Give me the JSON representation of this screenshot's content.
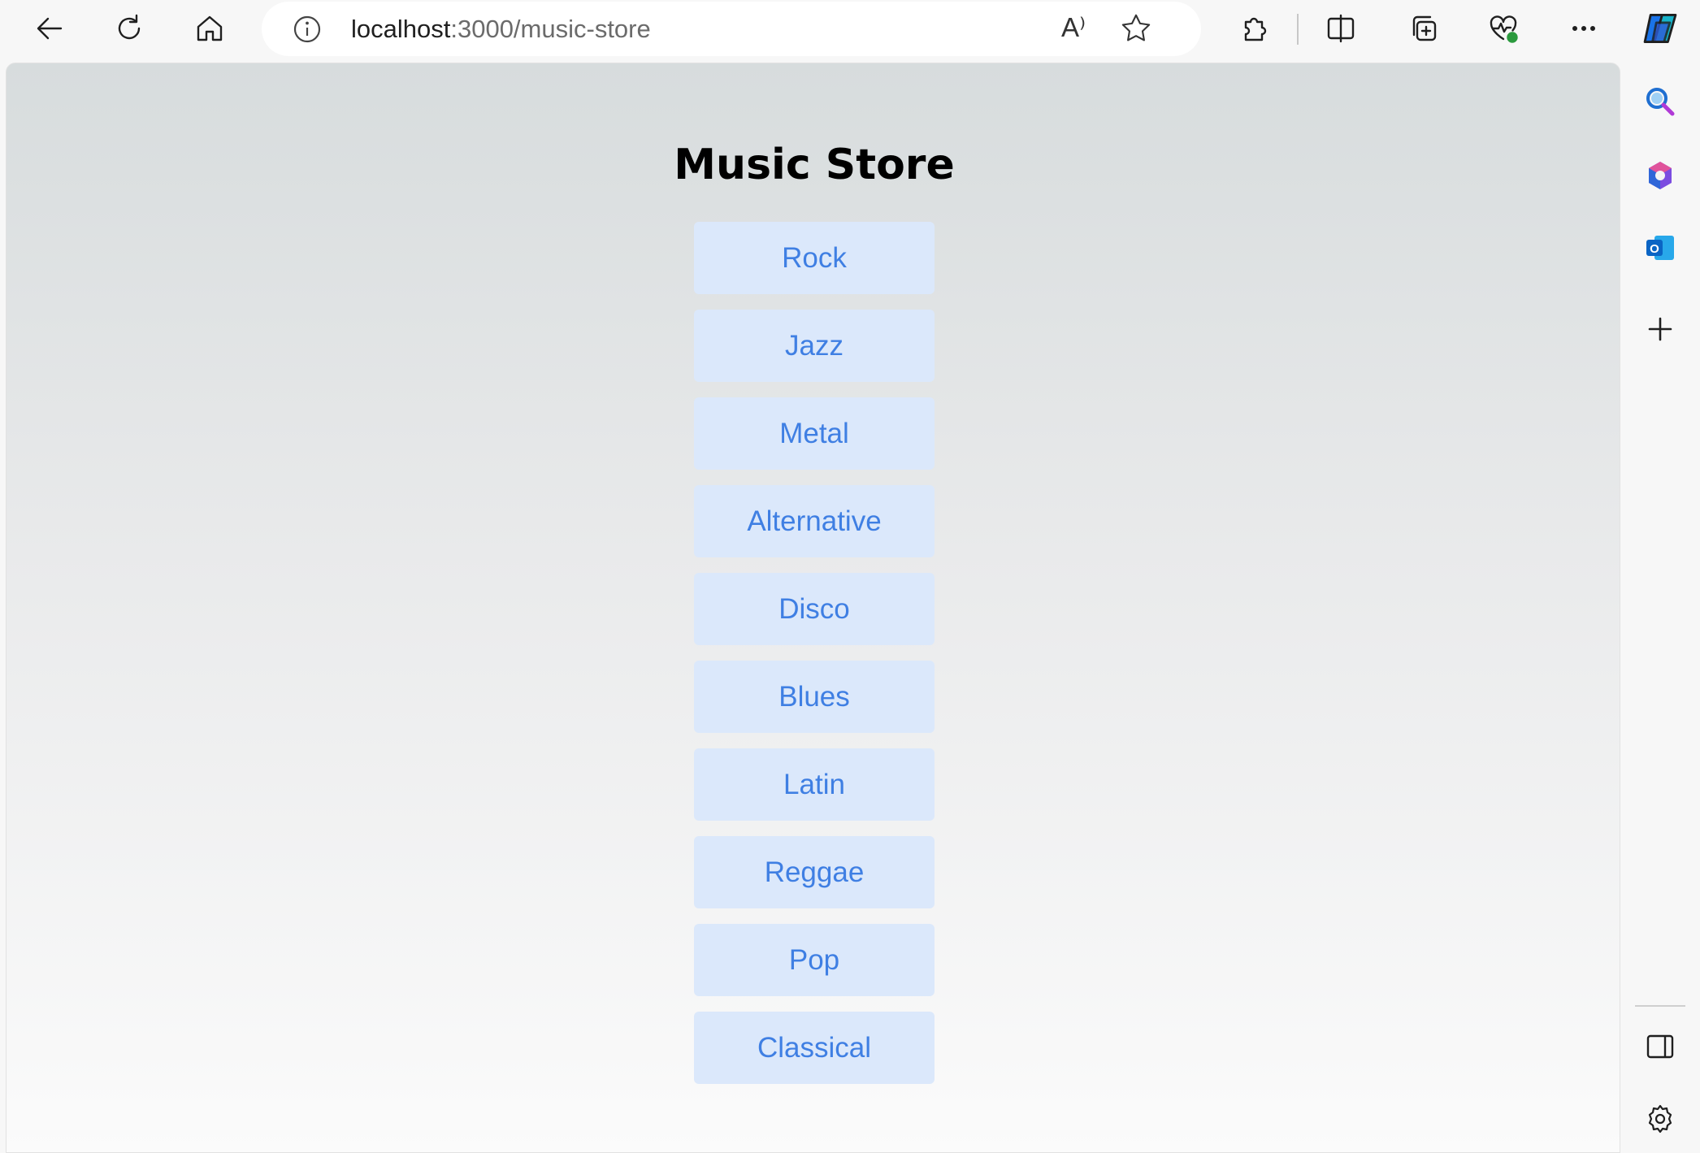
{
  "browser": {
    "url_host": "localhost",
    "url_rest": ":3000/music-store",
    "read_aloud_label": "A⁾"
  },
  "page": {
    "title": "Music Store",
    "genres": [
      "Rock",
      "Jazz",
      "Metal",
      "Alternative",
      "Disco",
      "Blues",
      "Latin",
      "Reggae",
      "Pop",
      "Classical"
    ]
  },
  "colors": {
    "button_bg": "#dbe8fb",
    "button_text": "#3f7fe3",
    "title_text": "#000000"
  }
}
